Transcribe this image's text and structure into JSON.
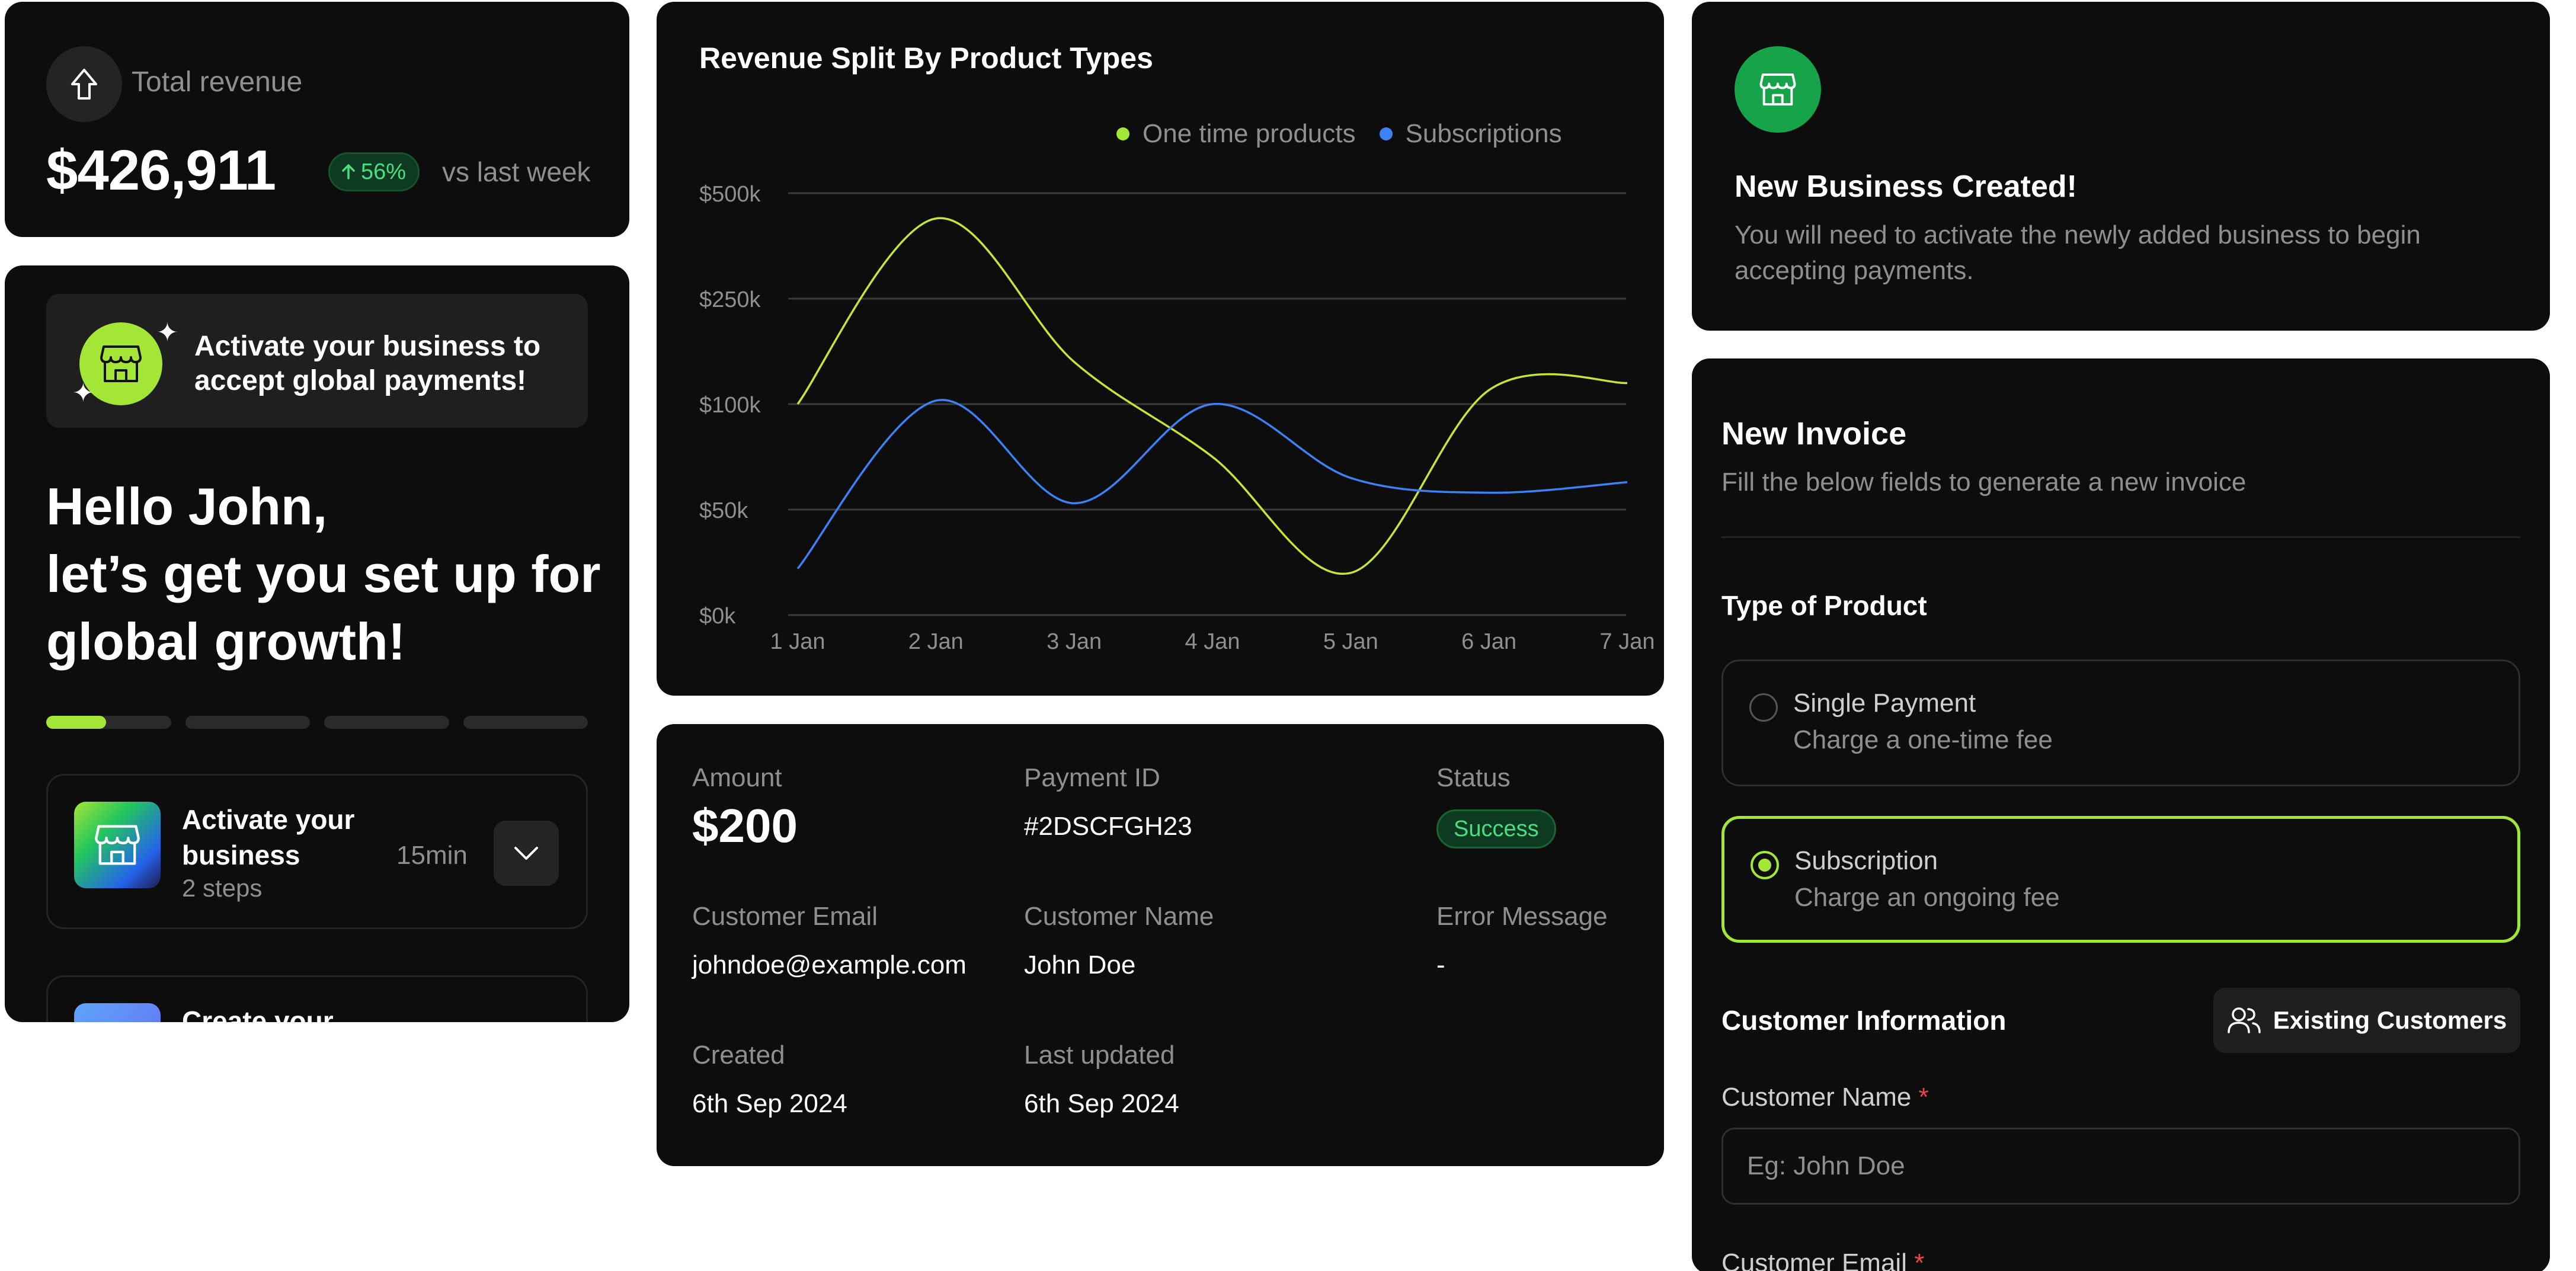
{
  "revenue": {
    "title": "Total revenue",
    "amount": "$426,911",
    "change": "56%",
    "comparison": "vs last week"
  },
  "onboarding": {
    "banner": "Activate your business to accept global payments!",
    "greeting_line1": "Hello John,",
    "greeting_line2": "let’s get you set up for global growth!",
    "progress_fraction": 0.12,
    "steps_total": 4,
    "tasks": [
      {
        "name": "Activate your business",
        "steps": "2 steps",
        "duration": "15min"
      },
      {
        "name": "Create your",
        "steps": "",
        "duration": ""
      }
    ]
  },
  "chart_card": {
    "title": "Revenue Split By Product Types",
    "legend": [
      "One time products",
      "Subscriptions"
    ]
  },
  "chart_data": {
    "type": "line",
    "title": "Revenue Split By Product Types",
    "categories": [
      "1 Jan",
      "2 Jan",
      "3 Jan",
      "4 Jan",
      "5 Jan",
      "6 Jan",
      "7 Jan"
    ],
    "y_ticks": [
      "$0k",
      "$50k",
      "$100k",
      "$250k",
      "$500k"
    ],
    "y_scale": "categorical-ticks",
    "grid": true,
    "legend_position": "top-right",
    "series": [
      {
        "name": "One time products",
        "color": "#c6e635",
        "values": [
          100,
          440,
          160,
          75,
          20,
          120,
          130
        ]
      },
      {
        "name": "Subscriptions",
        "color": "#3b82f6",
        "values": [
          22,
          105,
          53,
          100,
          65,
          58,
          63
        ]
      }
    ]
  },
  "payment": {
    "amount_label": "Amount",
    "amount": "$200",
    "payment_id_label": "Payment ID",
    "payment_id": "#2DSCFGH23",
    "status_label": "Status",
    "status": "Success",
    "email_label": "Customer Email",
    "email": "johndoe@example.com",
    "name_label": "Customer Name",
    "name": "John Doe",
    "error_label": "Error Message",
    "error": "-",
    "created_label": "Created",
    "created": "6th Sep 2024",
    "updated_label": "Last updated",
    "updated": "6th Sep 2024"
  },
  "business": {
    "title": "New Business Created!",
    "description": "You will need to activate the newly added business to begin accepting payments."
  },
  "invoice": {
    "title": "New Invoice",
    "description": "Fill the below fields to generate a new invoice",
    "product_type_label": "Type of Product",
    "options": [
      {
        "title": "Single Payment",
        "desc": "Charge a one-time fee",
        "selected": false
      },
      {
        "title": "Subscription",
        "desc": "Charge an ongoing fee",
        "selected": true
      }
    ],
    "customer_info_label": "Customer Information",
    "existing_button": "Existing Customers",
    "customer_name_label": "Customer Name",
    "customer_name_placeholder": "Eg: John Doe",
    "customer_email_label": "Customer Email",
    "required_mark": "*"
  },
  "colors": {
    "accent": "#a3e635",
    "success": "#4ade80",
    "series_one_time": "#c6e635",
    "series_subscriptions": "#3b82f6"
  },
  "icons": [
    "arrow-up-icon",
    "arrow-up-small-icon",
    "shop-icon",
    "sparkle-icon",
    "chevron-down-icon",
    "users-icon"
  ]
}
